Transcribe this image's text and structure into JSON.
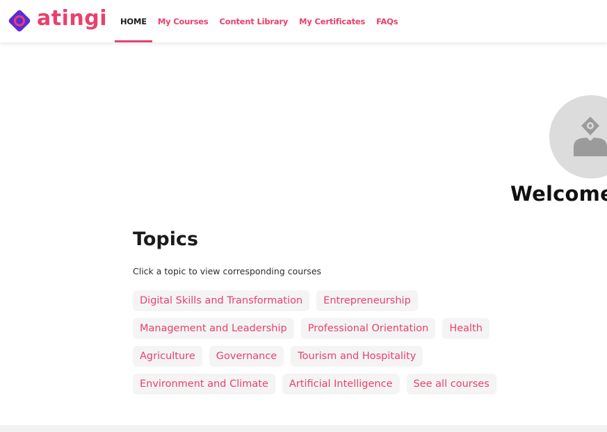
{
  "brand": {
    "name": "atingi",
    "accent": "#e8416c",
    "logo_purple": "#5b2bd9"
  },
  "nav": {
    "items": [
      {
        "label": "HOME",
        "active": true
      },
      {
        "label": "My Courses",
        "active": false
      },
      {
        "label": "Content Library",
        "active": false
      },
      {
        "label": "My Certificates",
        "active": false
      },
      {
        "label": "FAQs",
        "active": false
      }
    ]
  },
  "profile": {
    "avatar_icon": "user-placeholder-icon",
    "welcome": "Welcome,"
  },
  "topics": {
    "title": "Topics",
    "subtitle": "Click a topic to view corresponding courses",
    "chips": [
      [
        "Digital Skills and Transformation",
        "Entrepreneurship"
      ],
      [
        "Management and Leadership",
        "Professional Orientation",
        "Health"
      ],
      [
        "Agriculture",
        "Governance",
        "Tourism and Hospitality"
      ],
      [
        "Environment and Climate",
        "Artificial Intelligence",
        "See all courses"
      ]
    ]
  }
}
